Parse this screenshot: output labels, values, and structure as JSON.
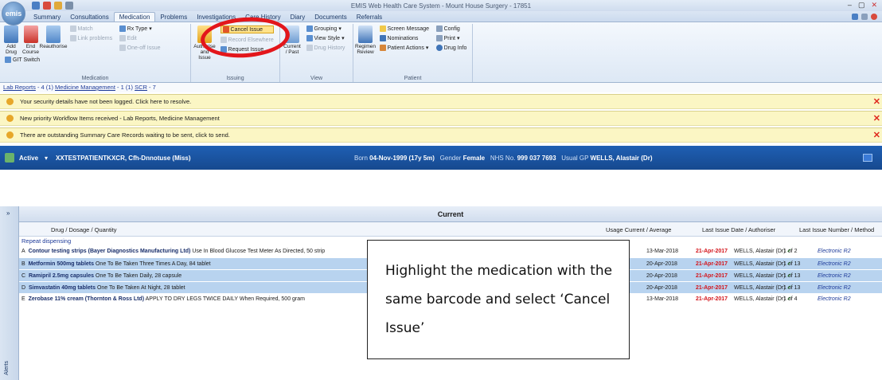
{
  "window": {
    "title": "EMIS Web Health Care System - Mount House Surgery - 17851",
    "logo": "emis",
    "controls": [
      "–",
      "▢",
      "✕"
    ]
  },
  "tabs": [
    "Summary",
    "Consultations",
    "Medication",
    "Problems",
    "Investigations",
    "Care History",
    "Diary",
    "Documents",
    "Referrals"
  ],
  "active_tab": "Medication",
  "ribbon": {
    "medication_group": {
      "name": "Medication",
      "add_drug": "Add Drug",
      "end_course": "End Course",
      "reauthorise": "Reauthorise",
      "match": "Match",
      "link_problems": "Link problems",
      "edit": "Edit",
      "rx_type": "Rx Type",
      "git_switch": "GIT Switch",
      "one_off_issue": "One-off Issue"
    },
    "issuing_group": {
      "name": "Issuing",
      "authorise_and_issue": "Authorise and Issue",
      "cancel_issue": "Cancel Issue",
      "record_elsewhere": "Record Elsewhere",
      "request_issue": "Request Issue"
    },
    "view_group": {
      "name": "View",
      "current_past": "Current / Past",
      "grouping": "Grouping",
      "view_style": "View Style",
      "drug_history": "Drug History"
    },
    "patient_group": {
      "name": "Patient",
      "regimen_review": "Regimen Review",
      "screen_message": "Screen Message",
      "nominations": "Nominations",
      "patient_actions": "Patient Actions",
      "config": "Config",
      "print": "Print",
      "drug_info": "Drug Info"
    }
  },
  "links_bar": {
    "lab_reports": "Lab Reports",
    "lab_count": "4 (1)",
    "medicine_management": "Medicine Management",
    "mm_count": "1 (1)",
    "scr": "SCR",
    "scr_count": "7"
  },
  "notices": [
    "Your security details have not been logged.  Click here to resolve.",
    "New priority Workflow Items received - Lab Reports, Medicine Management",
    "There are outstanding Summary Care Records waiting to be sent, click to send."
  ],
  "patient": {
    "status": "Active",
    "name": "XXTESTPATIENTKXCR, Cfh-Dnnotuse (Miss)",
    "born_label": "Born",
    "born": "04-Nov-1999 (17y 5m)",
    "gender_label": "Gender",
    "gender": "Female",
    "nhs_label": "NHS No.",
    "nhs": "999 037 7693",
    "gp_label": "Usual GP",
    "gp": "WELLS, Alastair (Dr)"
  },
  "left_pane_label": "Alerts",
  "section_title": "Current",
  "columns": {
    "drug": "Drug / Dosage / Quantity",
    "usage": "Usage Current / Average",
    "last_issue": "Last Issue Date / Authoriser",
    "last_number": "Last Issue Number / Method"
  },
  "group_label": "Repeat dispensing",
  "rows": [
    {
      "letter": "A",
      "name": "Contour testing strips (Bayer Diagnostics Manufacturing Ltd)",
      "dose": "Use In Blood Glucose Test Meter As Directed, 50 strip",
      "usage": "13-Mar-2018",
      "date": "21-Apr-2017",
      "auth": "WELLS, Alastair (Dr)",
      "num": "1 of 2",
      "method": "Electronic R2",
      "selected": false
    },
    {
      "letter": "B",
      "name": "Metformin 500mg tablets",
      "dose": "One To Be Taken Three Times A Day, 84 tablet",
      "usage": "20-Apr-2018",
      "date": "21-Apr-2017",
      "auth": "WELLS, Alastair (Dr)",
      "num": "1 of 13",
      "method": "Electronic R2",
      "selected": true
    },
    {
      "letter": "C",
      "name": "Ramipril 2.5mg capsules",
      "dose": "One To Be Taken Daily, 28 capsule",
      "usage": "20-Apr-2018",
      "date": "21-Apr-2017",
      "auth": "WELLS, Alastair (Dr)",
      "num": "1 of 13",
      "method": "Electronic R2",
      "selected": true
    },
    {
      "letter": "D",
      "name": "Simvastatin 40mg tablets",
      "dose": "One To Be Taken At Night, 28 tablet",
      "usage": "20-Apr-2018",
      "date": "21-Apr-2017",
      "auth": "WELLS, Alastair (Dr)",
      "num": "1 of 13",
      "method": "Electronic R2",
      "selected": true
    },
    {
      "letter": "E",
      "name": "Zerobase 11% cream (Thornton & Ross Ltd)",
      "dose": "APPLY TO DRY LEGS TWICE DAILY When Required, 500 gram",
      "usage": "13-Mar-2018",
      "date": "21-Apr-2017",
      "auth": "WELLS, Alastair (Dr)",
      "num": "1 of 4",
      "method": "Electronic R2",
      "selected": false
    }
  ],
  "callout_text": "Highlight the medication with the same barcode and select ‘Cancel Issue’",
  "colors": {
    "accent": "#1f5fb3",
    "highlight": "#e3161b",
    "selected_row": "#b8d3ef"
  }
}
